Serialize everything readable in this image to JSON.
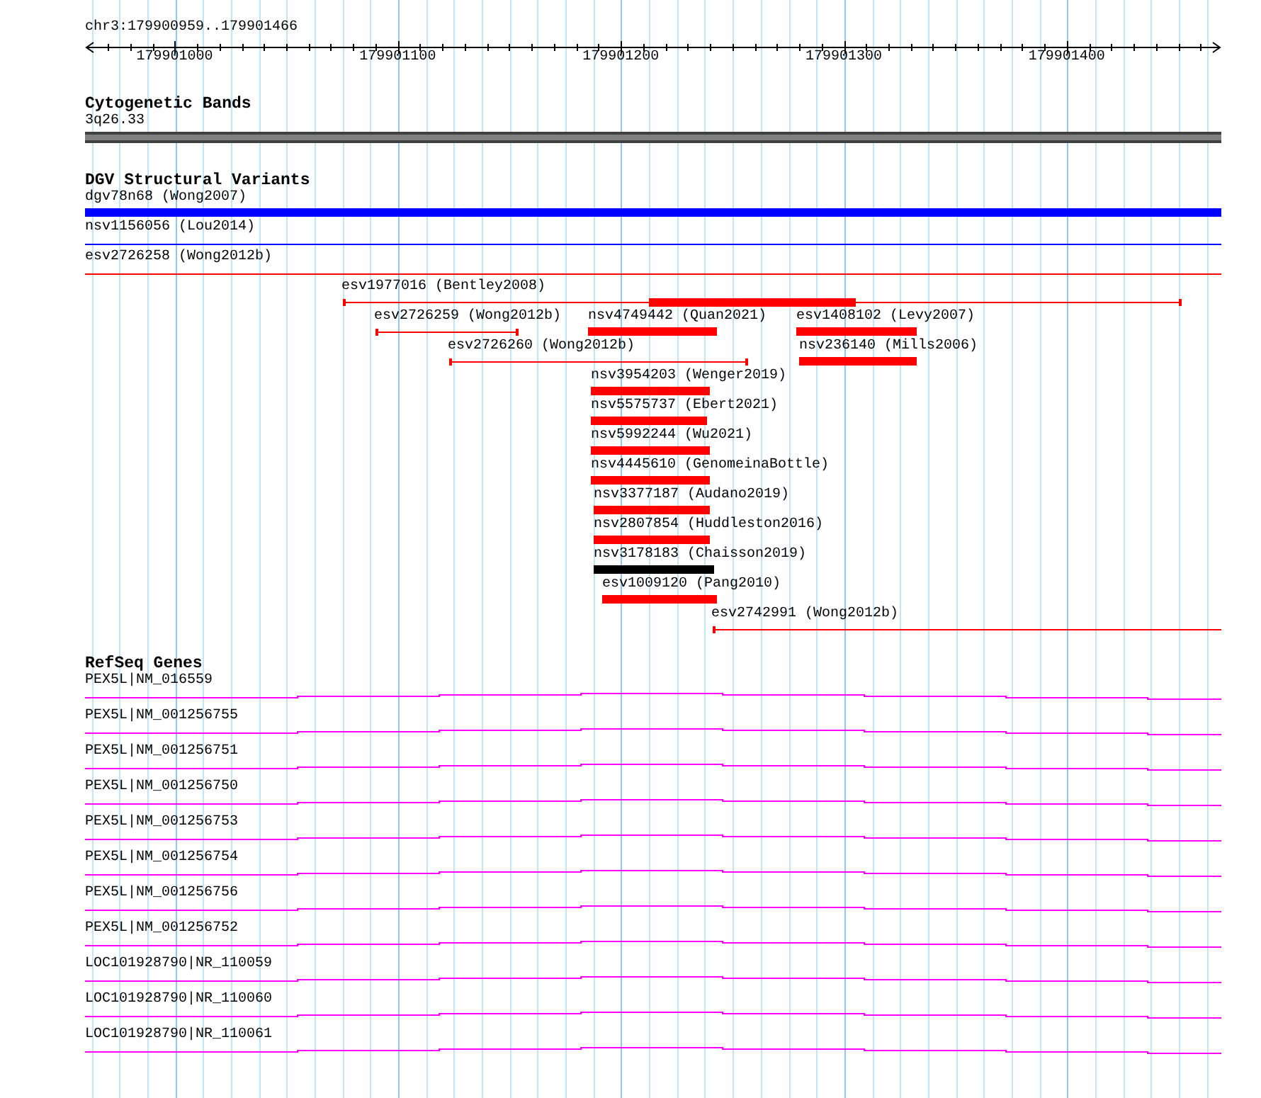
{
  "ruler": {
    "position": "chr3:179900959..179901466",
    "ticks": [
      "179901000",
      "179901100",
      "179901200",
      "179901300",
      "179901400"
    ]
  },
  "cytogenetic_bands": {
    "title": "Cytogenetic Bands",
    "band": {
      "label": "3q26.33"
    }
  },
  "dgv_structural_variants": {
    "title": "DGV Structural Variants",
    "features": [
      {
        "label": "dgv78n68 (Wong2007)",
        "kind": "thick",
        "color": "#0000ff"
      },
      {
        "label": "nsv1156056 (Lou2014)",
        "kind": "thin",
        "color": "#0000ff"
      },
      {
        "label": "esv2726258 (Wong2012b)",
        "kind": "thin",
        "color": "#ff0000"
      },
      {
        "label": "esv1977016 (Bentley2008)",
        "kind": "mixed",
        "color": "#ff0000"
      },
      {
        "label": "esv2726259 (Wong2012b)",
        "kind": "thin",
        "color": "#ff0000"
      },
      {
        "label": "nsv4749442 (Quan2021)",
        "kind": "thick",
        "color": "#ff0000"
      },
      {
        "label": "esv1408102 (Levy2007)",
        "kind": "thick",
        "color": "#ff0000"
      },
      {
        "label": "esv2726260 (Wong2012b)",
        "kind": "thin",
        "color": "#ff0000"
      },
      {
        "label": "nsv236140 (Mills2006)",
        "kind": "thick",
        "color": "#ff0000"
      },
      {
        "label": "nsv3954203 (Wenger2019)",
        "kind": "thick",
        "color": "#ff0000"
      },
      {
        "label": "nsv5575737 (Ebert2021)",
        "kind": "thick",
        "color": "#ff0000"
      },
      {
        "label": "nsv5992244 (Wu2021)",
        "kind": "thick",
        "color": "#ff0000"
      },
      {
        "label": "nsv4445610 (GenomeinaBottle)",
        "kind": "thick",
        "color": "#ff0000"
      },
      {
        "label": "nsv3377187 (Audano2019)",
        "kind": "thick",
        "color": "#ff0000"
      },
      {
        "label": "nsv2807854 (Huddleston2016)",
        "kind": "thick",
        "color": "#ff0000"
      },
      {
        "label": "nsv3178183 (Chaisson2019)",
        "kind": "thick",
        "color": "#000000"
      },
      {
        "label": "esv1009120 (Pang2010)",
        "kind": "thick",
        "color": "#ff0000"
      },
      {
        "label": "esv2742991 (Wong2012b)",
        "kind": "thin",
        "color": "#ff0000"
      }
    ]
  },
  "refseq_genes": {
    "title": "RefSeq Genes",
    "genes": [
      {
        "label": "PEX5L|NM_016559"
      },
      {
        "label": "PEX5L|NM_001256755"
      },
      {
        "label": "PEX5L|NM_001256751"
      },
      {
        "label": "PEX5L|NM_001256750"
      },
      {
        "label": "PEX5L|NM_001256753"
      },
      {
        "label": "PEX5L|NM_001256754"
      },
      {
        "label": "PEX5L|NM_001256756"
      },
      {
        "label": "PEX5L|NM_001256752"
      },
      {
        "label": "LOC101928790|NR_110059"
      },
      {
        "label": "LOC101928790|NR_110060"
      },
      {
        "label": "LOC101928790|NR_110061"
      }
    ]
  }
}
